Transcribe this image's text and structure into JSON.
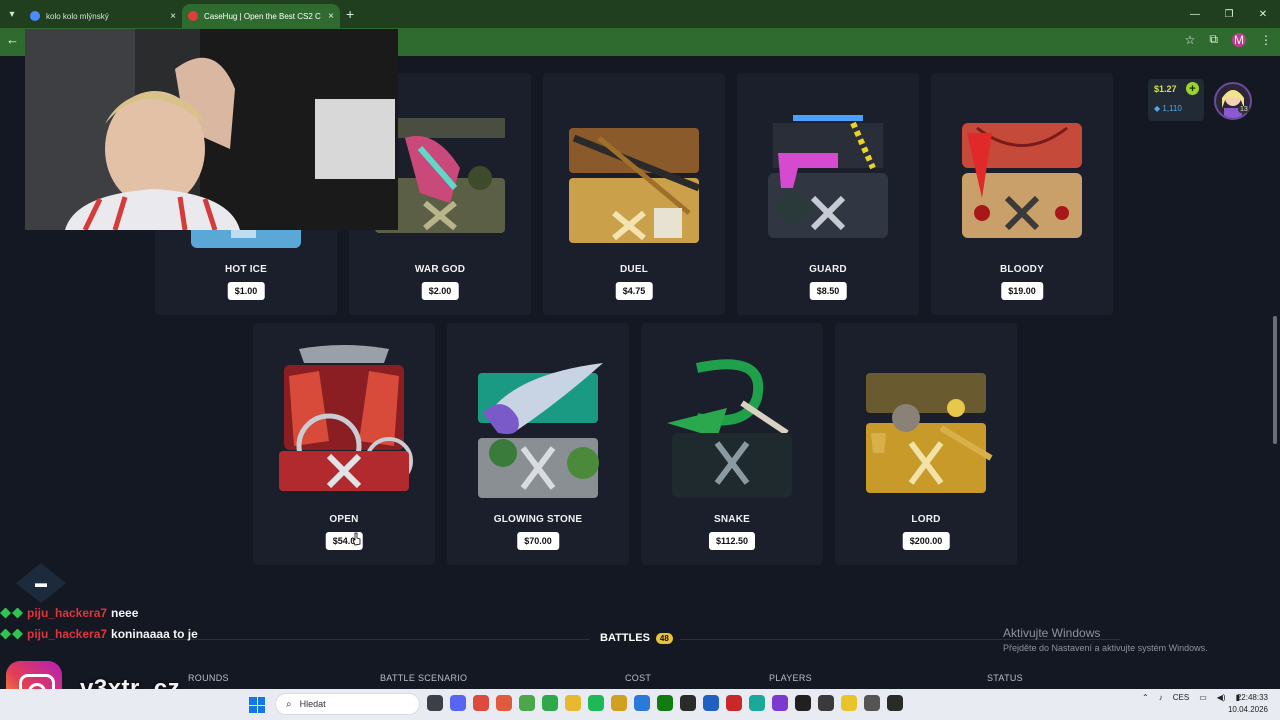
{
  "browser": {
    "tabs": [
      {
        "title": "kolo kolo mlýnský",
        "active": false,
        "favicon_color": "#4a8cff"
      },
      {
        "title": "CaseHug | Open the Best CS2 C",
        "active": true,
        "favicon_color": "#e23c3c"
      }
    ],
    "icons": {
      "tab_menu": "chevron-down-icon",
      "close": "×",
      "new_tab": "+",
      "back": "←",
      "star": "☆",
      "extensions": "⧉",
      "more": "⋮",
      "profile_letter": "M",
      "minimize": "—",
      "restore": "❐",
      "close_window": "✕"
    }
  },
  "wallet": {
    "balance": "$1.27",
    "add_symbol": "+",
    "coins": "1,110",
    "level": "13"
  },
  "cases_row1": [
    {
      "name": "HOT ICE",
      "price": "$1.00",
      "color": "#58a9d8"
    },
    {
      "name": "WAR GOD",
      "price": "$2.00",
      "color": "#6b6f4a"
    },
    {
      "name": "DUEL",
      "price": "$4.75",
      "color": "#c9a24a"
    },
    {
      "name": "GUARD",
      "price": "$8.50",
      "color": "#3a4050"
    },
    {
      "name": "BLOODY",
      "price": "$19.00",
      "color": "#b89060"
    }
  ],
  "cases_row2": [
    {
      "name": "OPEN",
      "price": "$54.0",
      "color": "#b83a3a"
    },
    {
      "name": "GLOWING STONE",
      "price": "$70.00",
      "color": "#2fa88a"
    },
    {
      "name": "SNAKE",
      "price": "$112.50",
      "color": "#1f5a3a"
    },
    {
      "name": "LORD",
      "price": "$200.00",
      "color": "#b8902a"
    }
  ],
  "battles": {
    "title": "BATTLES",
    "count": "48",
    "columns": [
      "ROUNDS",
      "BATTLE SCENARIO",
      "COST",
      "PLAYERS",
      "STATUS"
    ]
  },
  "watermark": {
    "line1": "Aktivujte Windows",
    "line2": "Přejděte do Nastavení a aktivujte systém Windows."
  },
  "chat": [
    {
      "user": "piju_hackera7",
      "message": "neee"
    },
    {
      "user": "piju_hackera7",
      "message": "koninaaaa to je"
    }
  ],
  "stream_handle": "v3xtr_cz",
  "taskbar": {
    "search_placeholder": "Hledat",
    "lang": "CES",
    "time": "22:48:33",
    "date": "10.04.2026"
  },
  "colors": {
    "chrome_green": "#2f6a2f",
    "page_bg": "#141823",
    "card_bg": "#1b1f2c",
    "accent_gold": "#e9c23c"
  }
}
